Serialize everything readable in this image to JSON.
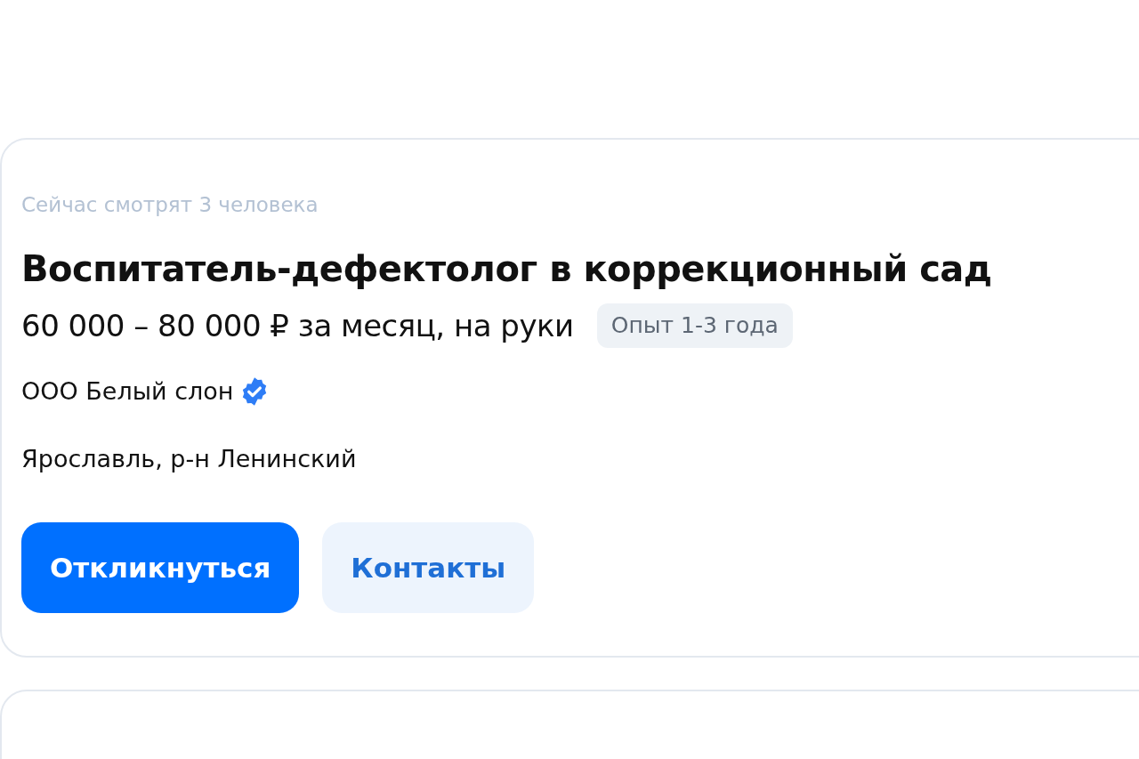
{
  "vacancy_card": {
    "viewers": "Сейчас смотрят 3 человека",
    "title": "Воспитатель-дефектолог в коррекционный сад",
    "salary": "60 000 – 80 000 ₽ за месяц, на руки",
    "experience": "Опыт 1-3 года",
    "company": {
      "name": "ООО Белый слон",
      "verified": true
    },
    "location": "Ярославль, р-н Ленинский",
    "buttons": [
      {
        "label": "Откликнуться",
        "kind": "primary"
      },
      {
        "label": "Контакты",
        "kind": "secondary"
      }
    ]
  }
}
